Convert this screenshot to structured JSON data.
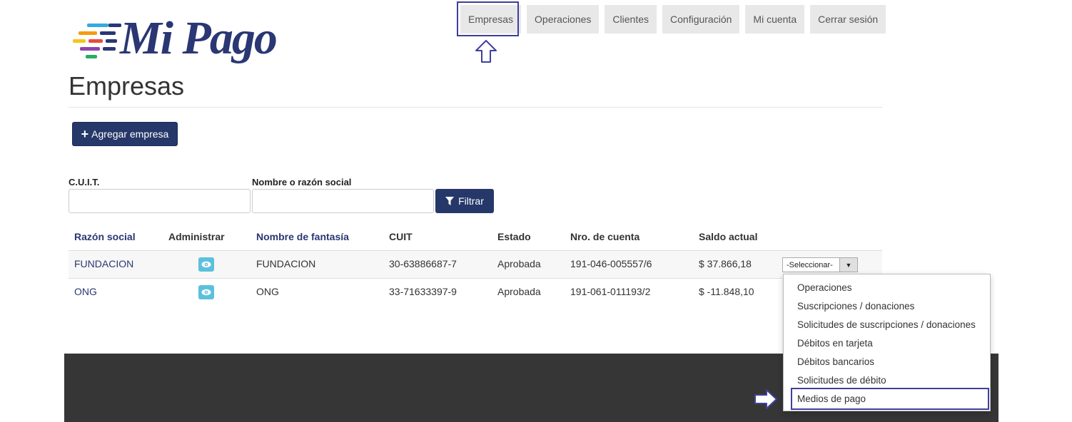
{
  "brand": {
    "logo_text": "Mi Pago",
    "color": "#2a3774"
  },
  "nav": {
    "items": [
      "Empresas",
      "Operaciones",
      "Clientes",
      "Configuración",
      "Mi cuenta",
      "Cerrar sesión"
    ],
    "active": "Empresas"
  },
  "page": {
    "title": "Empresas",
    "add_button": "Agregar empresa"
  },
  "filters": {
    "cuit_label": "C.U.I.T.",
    "cuit_value": "",
    "name_label": "Nombre o razón social",
    "name_value": "",
    "filter_button": "Filtrar"
  },
  "table": {
    "headers": [
      "Razón social",
      "Administrar",
      "Nombre de fantasía",
      "CUIT",
      "Estado",
      "Nro. de cuenta",
      "Saldo actual"
    ],
    "rows": [
      {
        "razon": "FUNDACION",
        "fantasia": "FUNDACION",
        "cuit": "30-63886687-7",
        "estado": "Aprobada",
        "cuenta": "191-046-005557/6",
        "saldo": "$ 37.866,18"
      },
      {
        "razon": "ONG",
        "fantasia": "ONG",
        "cuit": "33-71633397-9",
        "estado": "Aprobada",
        "cuenta": "191-061-011193/2",
        "saldo": "$ -11.848,10"
      }
    ],
    "select_placeholder": "-Seleccionar-"
  },
  "dropdown": {
    "items": [
      "Operaciones",
      "Suscripciones / donaciones",
      "Solicitudes de suscripciones / donaciones",
      "Débitos en tarjeta",
      "Débitos bancarios",
      "Solicitudes de débito",
      "Medios de pago"
    ],
    "highlighted": "Medios de pago"
  },
  "colors": {
    "primary": "#263869",
    "accent": "#5bc0de",
    "highlight_border": "#3f3f9c",
    "footer": "#363636"
  }
}
